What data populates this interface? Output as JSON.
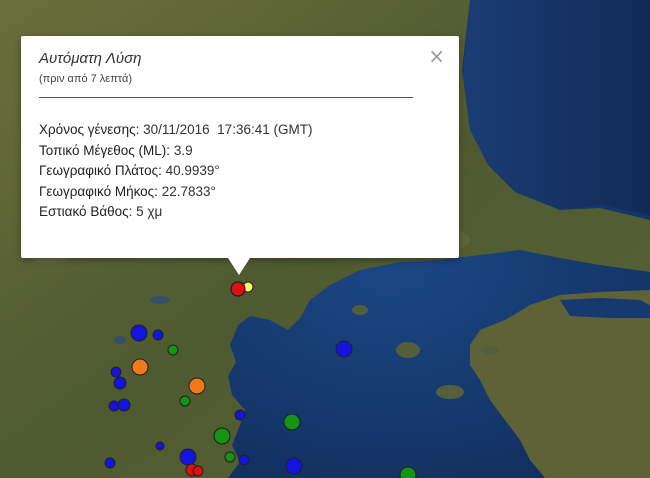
{
  "popup": {
    "title": "Αυτόματη Λύση",
    "subtitle": "(πριν από 7 λεπτά)",
    "close_label": "×",
    "rows": [
      {
        "label": "Χρόνος γένεσης:",
        "value": "30/11/2016  17:36:41 (GMT)"
      },
      {
        "label": "Τοπικό Μέγεθος (ML):",
        "value": "3.9"
      },
      {
        "label": "Γεωγραφικό Πλάτος:",
        "value": "40.9939°"
      },
      {
        "label": "Γεωγραφικό Μήκος:",
        "value": "22.7833°"
      },
      {
        "label": "Εστιακό Βάθος:",
        "value": "5 χμ"
      }
    ]
  },
  "colors": {
    "sea_deep": "#0f2a55",
    "land": "#56613a",
    "marker_red": "#e01010",
    "marker_blue": "#1414e0",
    "marker_orange": "#f07a1a",
    "marker_green": "#149414",
    "marker_yellow": "#ffff66"
  }
}
